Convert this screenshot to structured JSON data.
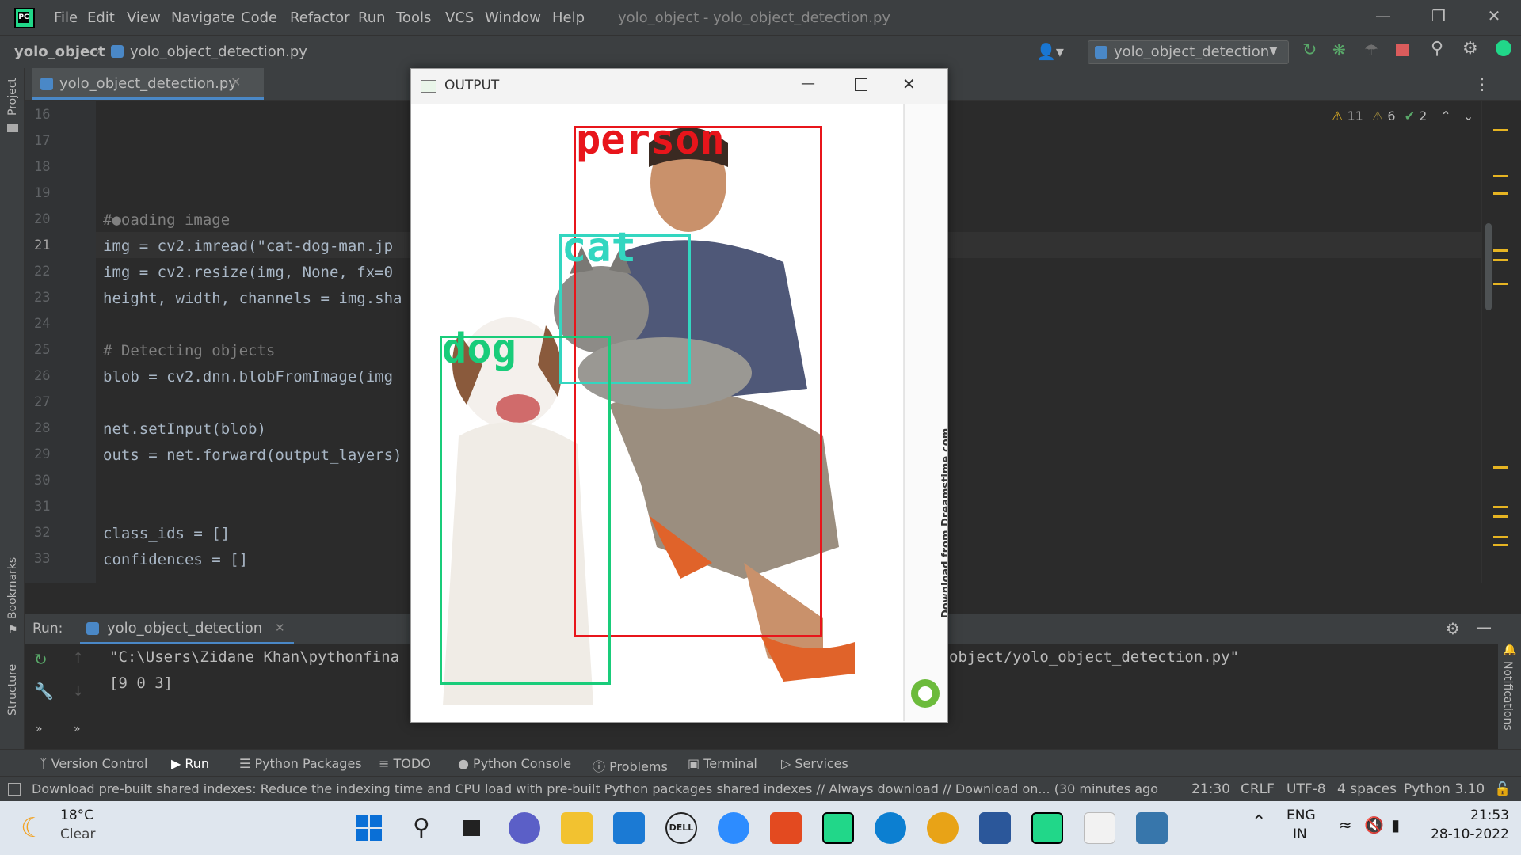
{
  "titlebar": {
    "menu": [
      "File",
      "Edit",
      "View",
      "Navigate",
      "Code",
      "Refactor",
      "Run",
      "Tools",
      "VCS",
      "Window",
      "Help"
    ],
    "window_title": "yolo_object - yolo_object_detection.py"
  },
  "navbar": {
    "project": "yolo_object",
    "file": "yolo_object_detection.py",
    "run_config": "yolo_object_detection"
  },
  "sidebar": {
    "project": "Project",
    "bookmarks": "Bookmarks",
    "structure": "Structure",
    "notifications": "Notifications"
  },
  "editor": {
    "tab": "yolo_object_detection.py",
    "inspections": {
      "warnings": "11",
      "weak_warnings": "6",
      "typos": "2"
    },
    "lines": [
      {
        "n": "16",
        "code": ""
      },
      {
        "n": "17",
        "code": ""
      },
      {
        "n": "18",
        "code": ""
      },
      {
        "n": "19",
        "code": ""
      },
      {
        "n": "20",
        "code": "#●oading image"
      },
      {
        "n": "21",
        "code": "img = cv2.imread(\"cat-dog-man.jp"
      },
      {
        "n": "22",
        "code": "img = cv2.resize(img, None, fx=0"
      },
      {
        "n": "23",
        "code": "height, width, channels = img.sha"
      },
      {
        "n": "24",
        "code": ""
      },
      {
        "n": "25",
        "code": "# Detecting objects"
      },
      {
        "n": "26",
        "code": "blob = cv2.dnn.blobFromImage(img"
      },
      {
        "n": "27",
        "code": ""
      },
      {
        "n": "28",
        "code": "net.setInput(blob)"
      },
      {
        "n": "29",
        "code": "outs = net.forward(output_layers)"
      },
      {
        "n": "30",
        "code": ""
      },
      {
        "n": "31",
        "code": ""
      },
      {
        "n": "32",
        "code": "class_ids = []"
      },
      {
        "n": "33",
        "code": "confidences = []"
      }
    ]
  },
  "run": {
    "label": "Run:",
    "tab": "yolo_object_detection",
    "output_line1_left": "\"C:\\Users\\Zidane Khan\\pythonfina",
    "output_line1_right": "object/yolo_object_detection.py\"",
    "output_line2": "[9 0 3]"
  },
  "bottom_tools": [
    "Version Control",
    "Run",
    "Python Packages",
    "TODO",
    "Python Console",
    "Problems",
    "Terminal",
    "Services"
  ],
  "statusbar": {
    "message": "Download pre-built shared indexes: Reduce the indexing time and CPU load with pre-built Python packages shared indexes // Always download // Download on... (30 minutes ago",
    "position": "21:30",
    "line_sep": "CRLF",
    "encoding": "UTF-8",
    "indent": "4 spaces",
    "interpreter": "Python 3.10"
  },
  "popup": {
    "title": "OUTPUT",
    "labels": {
      "person": "person",
      "cat": "cat",
      "dog": "dog"
    },
    "colors": {
      "person": "#e8151b",
      "cat": "#33d6c0",
      "dog": "#19cc7a"
    },
    "watermark": "Download from Dreamstime.com"
  },
  "taskbar": {
    "weather_temp": "18°C",
    "weather_desc": "Clear",
    "lang": "ENG",
    "region": "IN",
    "time": "21:53",
    "date": "28-10-2022"
  }
}
